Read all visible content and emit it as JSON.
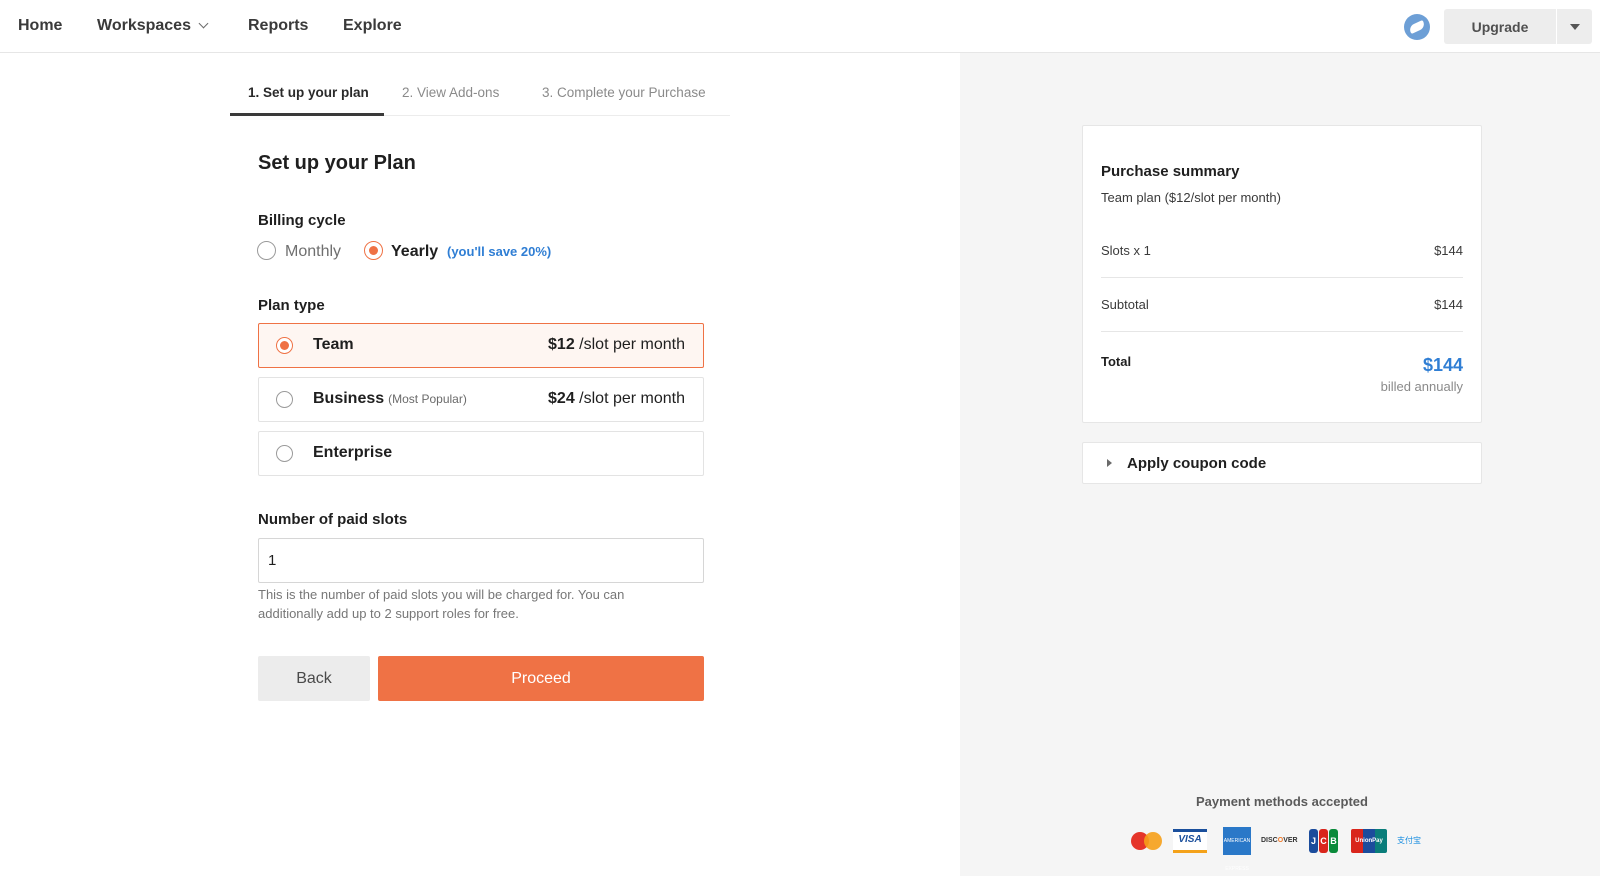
{
  "nav": {
    "items": [
      "Home",
      "Workspaces",
      "Reports",
      "Explore"
    ],
    "upgrade_label": "Upgrade"
  },
  "stepper": {
    "steps": [
      "1. Set up your plan",
      "2. View Add-ons",
      "3. Complete your Purchase"
    ],
    "active_index": 0
  },
  "form": {
    "title": "Set up your Plan",
    "billing_cycle": {
      "label": "Billing cycle",
      "options": [
        "Monthly",
        "Yearly"
      ],
      "selected": "Yearly",
      "save_note": "(you'll save 20%)"
    },
    "plan_type": {
      "label": "Plan type",
      "plans": [
        {
          "name": "Team",
          "tag": "",
          "price": "$12",
          "unit": " /slot per month",
          "selected": true
        },
        {
          "name": "Business",
          "tag": "(Most Popular)",
          "price": "$24",
          "unit": " /slot per month",
          "selected": false
        },
        {
          "name": "Enterprise",
          "tag": "",
          "price": "",
          "unit": "",
          "selected": false
        }
      ]
    },
    "slots": {
      "label": "Number of paid slots",
      "value": "1",
      "help": "This is the number of paid slots you will be charged for. You can additionally add up to 2 support roles for free."
    },
    "back_label": "Back",
    "proceed_label": "Proceed"
  },
  "summary": {
    "title": "Purchase summary",
    "subtitle": "Team plan ($12/slot per month)",
    "rows": [
      {
        "label": "Slots x 1",
        "value": "$144"
      },
      {
        "label": "Subtotal",
        "value": "$144"
      }
    ],
    "total_label": "Total",
    "total_value": "$144",
    "billed_note": "billed annually"
  },
  "coupon": {
    "label": "Apply coupon code"
  },
  "payment": {
    "title": "Payment methods accepted",
    "methods": [
      "mastercard-icon",
      "visa-icon",
      "amex-icon",
      "discover-icon",
      "jcb-icon",
      "unionpay-icon",
      "alipay-icon"
    ]
  },
  "colors": {
    "accent": "#ef7245",
    "link": "#2f7ed4",
    "sidebar_bg": "#f5f5f5"
  }
}
